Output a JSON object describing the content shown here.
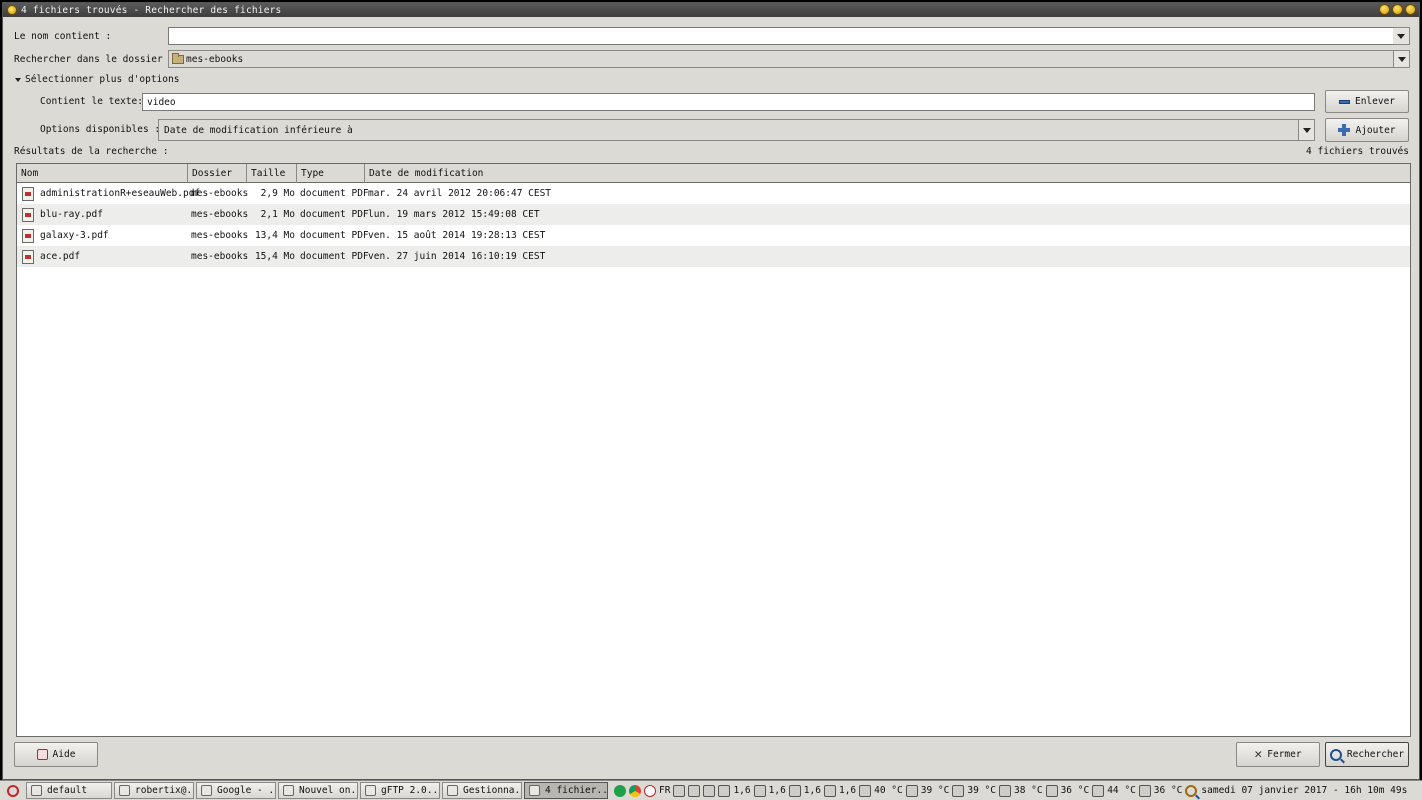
{
  "window": {
    "title": "4 fichiers trouvés - Rechercher des fichiers"
  },
  "form": {
    "name_label": "Le nom contient :",
    "name_value": "",
    "folder_label": "Rechercher dans le dossier :",
    "folder_value": "mes-ebooks",
    "more_options": "Sélectionner plus d'options",
    "contains_label": "Contient le texte:",
    "contains_value": "video",
    "remove_button": "Enlever",
    "available_label": "Options disponibles :",
    "available_value": "Date de modification inférieure à",
    "add_button": "Ajouter"
  },
  "results": {
    "label": "Résultats de la recherche :",
    "count": "4 fichiers trouvés",
    "columns": [
      "Nom",
      "Dossier",
      "Taille",
      "Type",
      "Date de modification"
    ],
    "rows": [
      {
        "name": "administrationR+eseauWeb.pdf",
        "folder": "mes-ebooks",
        "size": "2,9 Mo",
        "type": "document PDF",
        "date": "mar. 24 avril 2012 20:06:47 CEST"
      },
      {
        "name": "blu-ray.pdf",
        "folder": "mes-ebooks",
        "size": "2,1 Mo",
        "type": "document PDF",
        "date": "lun. 19 mars 2012 15:49:08 CET"
      },
      {
        "name": "galaxy-3.pdf",
        "folder": "mes-ebooks",
        "size": "13,4 Mo",
        "type": "document PDF",
        "date": "ven. 15 août 2014 19:28:13 CEST"
      },
      {
        "name": "ace.pdf",
        "folder": "mes-ebooks",
        "size": "15,4 Mo",
        "type": "document PDF",
        "date": "ven. 27 juin 2014 16:10:19 CEST"
      }
    ]
  },
  "footer": {
    "help_button": "Aide",
    "close_button": "Fermer",
    "search_button": "Rechercher"
  },
  "taskbar": {
    "tasks": [
      "default",
      "robertix@...",
      "Google - ...",
      "Nouvel on...",
      "gFTP 2.0...",
      "Gestionna...",
      "4 fichier..."
    ],
    "tray": {
      "lang": "FR",
      "cpu": [
        "1,6",
        "1,6",
        "1,6",
        "1,6"
      ],
      "temps": [
        "40 °C",
        "39 °C",
        "39 °C",
        "38 °C",
        "36 °C",
        "44 °C",
        "36 °C"
      ],
      "clock": "samedi 07 janvier 2017 - 16h 10m 49s"
    }
  },
  "colors": {
    "accent": "#3a6cb3",
    "window_bg": "#dcdad5",
    "title_bg": "#4a4a4a"
  }
}
